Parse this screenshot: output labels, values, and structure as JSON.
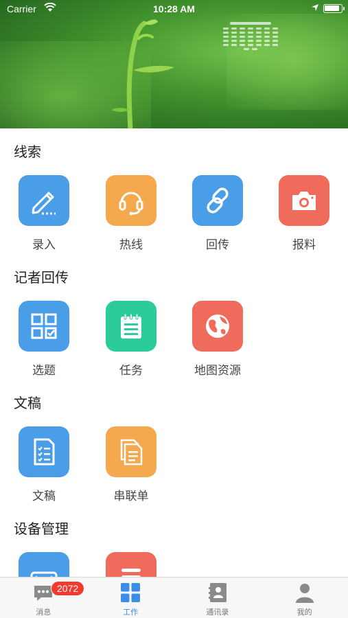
{
  "status_bar": {
    "carrier": "Carrier",
    "time": "10:28 AM"
  },
  "sections": [
    {
      "title": "线索",
      "items": [
        {
          "label": "录入",
          "icon": "pencil-icon",
          "color": "#4a9ee8"
        },
        {
          "label": "热线",
          "icon": "headset-icon",
          "color": "#f4a94f"
        },
        {
          "label": "回传",
          "icon": "link-icon",
          "color": "#4a9ee8"
        },
        {
          "label": "报料",
          "icon": "camera-icon",
          "color": "#ef6b5b"
        }
      ]
    },
    {
      "title": "记者回传",
      "items": [
        {
          "label": "选题",
          "icon": "grid-check-icon",
          "color": "#4a9ee8"
        },
        {
          "label": "任务",
          "icon": "notepad-icon",
          "color": "#2ccb9b"
        },
        {
          "label": "地图资源",
          "icon": "globe-icon",
          "color": "#ef6b5b"
        }
      ]
    },
    {
      "title": "文稿",
      "items": [
        {
          "label": "文稿",
          "icon": "document-list-icon",
          "color": "#4a9ee8"
        },
        {
          "label": "串联单",
          "icon": "documents-icon",
          "color": "#f4a94f"
        }
      ]
    },
    {
      "title": "设备管理",
      "items": [
        {
          "label": "",
          "icon": "device-icon",
          "color": "#4a9ee8"
        },
        {
          "label": "",
          "icon": "list-icon",
          "color": "#ef6b5b"
        }
      ]
    }
  ],
  "tabbar": {
    "tabs": [
      {
        "label": "消息",
        "icon": "message-icon",
        "badge": "2072",
        "active": false
      },
      {
        "label": "工作",
        "icon": "apps-icon",
        "active": true
      },
      {
        "label": "通讯录",
        "icon": "contacts-icon",
        "active": false
      },
      {
        "label": "我的",
        "icon": "profile-icon",
        "active": false
      }
    ]
  },
  "colors": {
    "accent": "#3a8ee6",
    "badge": "#f23a2f"
  }
}
